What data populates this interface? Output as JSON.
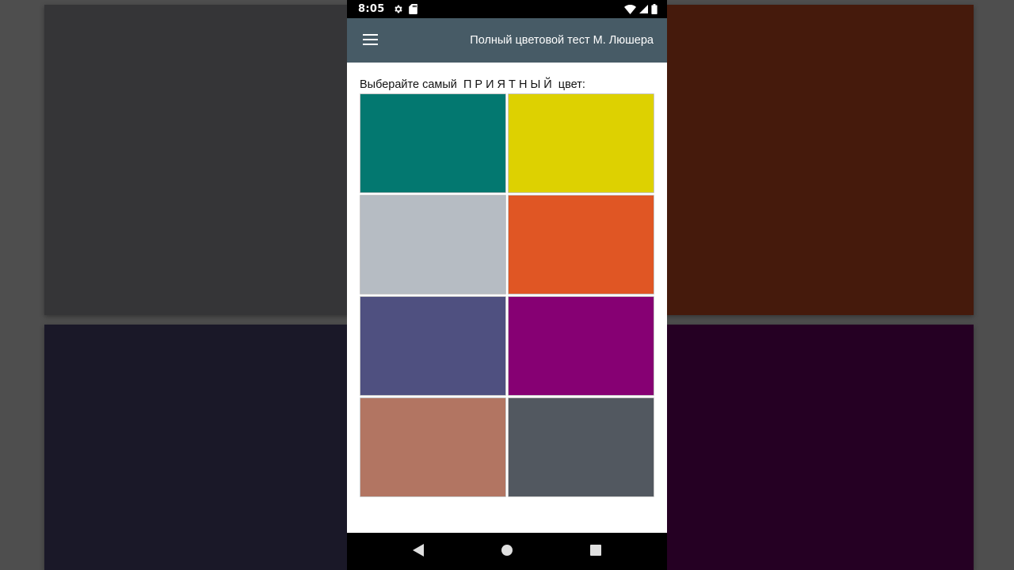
{
  "status_bar": {
    "time": "8:05",
    "icons": [
      "gear-icon",
      "sd-card-icon",
      "wifi-icon",
      "signal-icon",
      "battery-icon"
    ]
  },
  "app_bar": {
    "menu_icon": "hamburger-menu-icon",
    "title": "Полный цветовой тест М. Люшера"
  },
  "content": {
    "prompt": "Выберайте самый  П Р И Я Т Н Ы Й  цвет:",
    "swatches": [
      {
        "color": "#037870"
      },
      {
        "color": "#ddd101"
      },
      {
        "color": "#b6bcc3"
      },
      {
        "color": "#e05624"
      },
      {
        "color": "#4f5080"
      },
      {
        "color": "#860073"
      },
      {
        "color": "#b27562"
      },
      {
        "color": "#525860"
      }
    ]
  },
  "nav_bar": {
    "buttons": [
      "back-icon",
      "home-icon",
      "recents-icon"
    ]
  },
  "background": {
    "tiles": [
      "#353537",
      "#451a0c",
      "#1a1828",
      "#250023"
    ]
  }
}
